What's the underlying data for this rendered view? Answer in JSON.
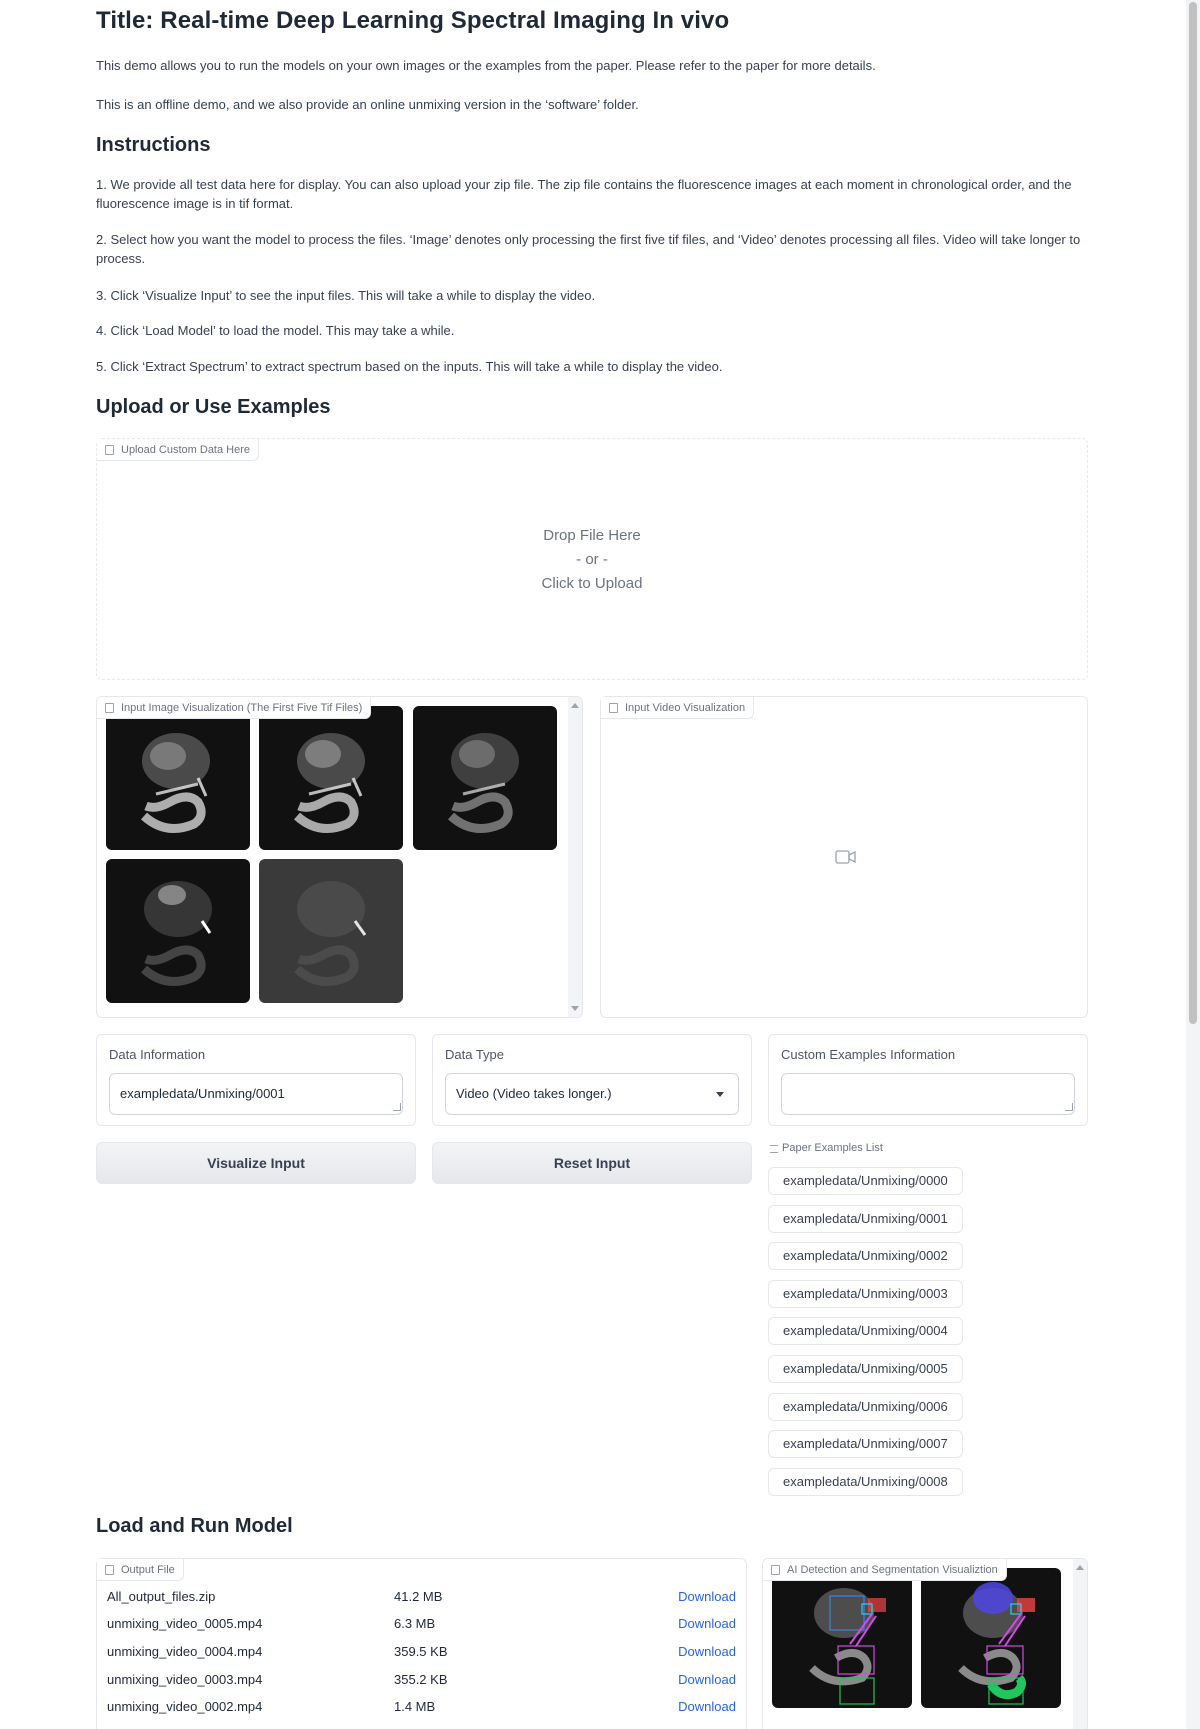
{
  "title": "Title: Real-time Deep Learning Spectral Imaging In vivo",
  "intro": [
    "This demo allows you to run the models on your own images or the examples from the paper. Please refer to the paper for more details.",
    "This is an offline demo, and we also provide an online unmixing version in the ‘software’ folder."
  ],
  "instructions": {
    "heading": "Instructions",
    "steps": [
      "1. We provide all test data here for display. You can also upload your zip file. The zip file contains the fluorescence images at each moment in chronological order, and the fluorescence image is in tif format.",
      "2. Select how you want the model to process the files. ‘Image’ denotes only processing the first five tif files, and ‘Video’ denotes processing all files. Video will take longer to process.",
      "3. Click ‘Visualize Input’ to see the input files. This will take a while to display the video.",
      "4. Click ‘Load Model’ to load the model. This may take a while.",
      "5. Click ‘Extract Spectrum’ to extract spectrum based on the inputs. This will take a while to display the video."
    ]
  },
  "upload_section": {
    "heading": "Upload or Use Examples",
    "upload_label": "Upload Custom Data Here",
    "drop_line1": "Drop File Here",
    "drop_line2": "- or -",
    "drop_line3": "Click to Upload"
  },
  "gallery": {
    "label": "Input Image Visualization (The First Five Tif Files)"
  },
  "video": {
    "label": "Input Video Visualization"
  },
  "fields": {
    "data_info": {
      "label": "Data Information",
      "value": "exampledata/Unmixing/0001"
    },
    "data_type": {
      "label": "Data Type",
      "value": "Video (Video takes longer.)"
    },
    "custom_info": {
      "label": "Custom Examples Information",
      "value": ""
    }
  },
  "buttons": {
    "visualize": "Visualize Input",
    "reset": "Reset Input"
  },
  "examples": {
    "label": "Paper Examples List",
    "items": [
      "exampledata/Unmixing/0000",
      "exampledata/Unmixing/0001",
      "exampledata/Unmixing/0002",
      "exampledata/Unmixing/0003",
      "exampledata/Unmixing/0004",
      "exampledata/Unmixing/0005",
      "exampledata/Unmixing/0006",
      "exampledata/Unmixing/0007",
      "exampledata/Unmixing/0008"
    ]
  },
  "run_section": {
    "heading": "Load and Run Model"
  },
  "output": {
    "label": "Output File",
    "download_label": "Download",
    "files": [
      {
        "name": "All_output_files.zip",
        "size": "41.2 MB"
      },
      {
        "name": "unmixing_video_0005.mp4",
        "size": "6.3 MB"
      },
      {
        "name": "unmixing_video_0004.mp4",
        "size": "359.5 KB"
      },
      {
        "name": "unmixing_video_0003.mp4",
        "size": "355.2 KB"
      },
      {
        "name": "unmixing_video_0002.mp4",
        "size": "1.4 MB"
      }
    ]
  },
  "ai": {
    "label": "AI Detection and Segmentation Visualiztion"
  },
  "colors": {
    "link": "#2563eb",
    "border": "#e5e7eb",
    "text": "#1f2937"
  }
}
